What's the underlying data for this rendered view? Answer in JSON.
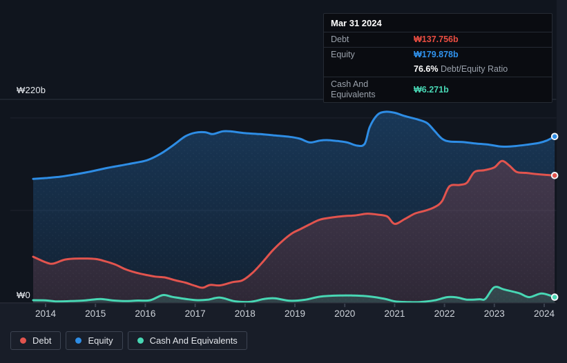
{
  "tooltip": {
    "date": "Mar 31 2024",
    "debt_label": "Debt",
    "debt_value": "₩137.756b",
    "equity_label": "Equity",
    "equity_value": "₩179.878b",
    "ratio_value": "76.6%",
    "ratio_label": "Debt/Equity Ratio",
    "cash_label": "Cash And Equivalents",
    "cash_value": "₩6.271b"
  },
  "legend": [
    {
      "label": "Debt",
      "key": "debt"
    },
    {
      "label": "Equity",
      "key": "equity"
    },
    {
      "label": "Cash And Equivalents",
      "key": "cash"
    }
  ],
  "colors": {
    "debt": "#e2544e",
    "equity": "#2e8de5",
    "cash": "#48d7b4",
    "page_bg": "#181d28",
    "plot_bg": "#10151e",
    "grid_major": "#2d323d",
    "grid_minor": "#1f242f",
    "tick": "#3a414e",
    "axis_text": "#ced3da"
  },
  "chart_data": {
    "type": "area",
    "x_unit": "year",
    "x_range": [
      2013.75,
      2024.21
    ],
    "x_ticks": [
      "2014",
      "2015",
      "2016",
      "2017",
      "2018",
      "2019",
      "2020",
      "2021",
      "2022",
      "2023",
      "2024"
    ],
    "ylim": [
      0,
      220
    ],
    "y_axis_labels": {
      "top": "₩220b",
      "zero": "₩0"
    },
    "gridlines_major": [
      220,
      0
    ],
    "gridlines_minor": [
      200,
      100
    ],
    "legend_position": "bottom-left",
    "end_point": {
      "date": "Mar 31 2024",
      "debt_b": 137.756,
      "equity_b": 179.878,
      "cash_b": 6.271,
      "debt_equity_ratio_pct": 76.6
    },
    "series": [
      {
        "name": "Equity",
        "key": "equity",
        "color": "#2e8de5",
        "points": [
          [
            2013.75,
            134
          ],
          [
            2014.0,
            135
          ],
          [
            2014.3,
            136.5
          ],
          [
            2014.6,
            139
          ],
          [
            2014.9,
            142
          ],
          [
            2015.2,
            145.5
          ],
          [
            2015.5,
            148.5
          ],
          [
            2015.8,
            151.5
          ],
          [
            2016.05,
            154.5
          ],
          [
            2016.3,
            161
          ],
          [
            2016.55,
            170
          ],
          [
            2016.8,
            180
          ],
          [
            2017.0,
            184
          ],
          [
            2017.2,
            184.5
          ],
          [
            2017.35,
            182.5
          ],
          [
            2017.55,
            185.5
          ],
          [
            2017.7,
            185.5
          ],
          [
            2018.0,
            183.5
          ],
          [
            2018.3,
            182.5
          ],
          [
            2018.6,
            181
          ],
          [
            2018.9,
            179.5
          ],
          [
            2019.1,
            177.5
          ],
          [
            2019.3,
            173.5
          ],
          [
            2019.5,
            175.5
          ],
          [
            2019.65,
            176
          ],
          [
            2019.85,
            175
          ],
          [
            2020.05,
            173.5
          ],
          [
            2020.25,
            170
          ],
          [
            2020.4,
            172
          ],
          [
            2020.5,
            190
          ],
          [
            2020.65,
            203
          ],
          [
            2020.8,
            206.5
          ],
          [
            2021.0,
            205.5
          ],
          [
            2021.2,
            202
          ],
          [
            2021.45,
            198.5
          ],
          [
            2021.65,
            194.5
          ],
          [
            2021.8,
            186
          ],
          [
            2021.95,
            177.5
          ],
          [
            2022.1,
            174.5
          ],
          [
            2022.35,
            174
          ],
          [
            2022.6,
            172.5
          ],
          [
            2022.9,
            171
          ],
          [
            2023.15,
            169
          ],
          [
            2023.4,
            169.5
          ],
          [
            2023.65,
            171
          ],
          [
            2023.9,
            173
          ],
          [
            2024.05,
            175.5
          ],
          [
            2024.21,
            179.878
          ]
        ]
      },
      {
        "name": "Debt",
        "key": "debt",
        "color": "#e2544e",
        "points": [
          [
            2013.75,
            50
          ],
          [
            2014.0,
            44
          ],
          [
            2014.15,
            42.5
          ],
          [
            2014.4,
            47
          ],
          [
            2014.7,
            48
          ],
          [
            2015.0,
            47.5
          ],
          [
            2015.2,
            45
          ],
          [
            2015.4,
            41.5
          ],
          [
            2015.6,
            36.5
          ],
          [
            2015.8,
            33
          ],
          [
            2016.0,
            30.5
          ],
          [
            2016.2,
            28.5
          ],
          [
            2016.4,
            27.5
          ],
          [
            2016.6,
            24.5
          ],
          [
            2016.8,
            22
          ],
          [
            2017.0,
            18.5
          ],
          [
            2017.15,
            16.5
          ],
          [
            2017.3,
            19.5
          ],
          [
            2017.5,
            19
          ],
          [
            2017.75,
            22.5
          ],
          [
            2017.95,
            24.5
          ],
          [
            2018.15,
            32.5
          ],
          [
            2018.35,
            44
          ],
          [
            2018.55,
            56.5
          ],
          [
            2018.75,
            67
          ],
          [
            2018.95,
            75.5
          ],
          [
            2019.1,
            79.5
          ],
          [
            2019.3,
            85
          ],
          [
            2019.5,
            90
          ],
          [
            2019.75,
            92.5
          ],
          [
            2020.0,
            94
          ],
          [
            2020.2,
            94.5
          ],
          [
            2020.45,
            96.5
          ],
          [
            2020.65,
            95.5
          ],
          [
            2020.85,
            93.5
          ],
          [
            2021.0,
            85.5
          ],
          [
            2021.2,
            90.5
          ],
          [
            2021.4,
            96.5
          ],
          [
            2021.6,
            99.5
          ],
          [
            2021.8,
            103.5
          ],
          [
            2021.95,
            110
          ],
          [
            2022.1,
            126
          ],
          [
            2022.3,
            127.5
          ],
          [
            2022.45,
            130
          ],
          [
            2022.6,
            141.5
          ],
          [
            2022.8,
            143.5
          ],
          [
            2023.0,
            146.5
          ],
          [
            2023.15,
            153.5
          ],
          [
            2023.3,
            148.5
          ],
          [
            2023.45,
            141.5
          ],
          [
            2023.65,
            140.5
          ],
          [
            2023.9,
            139
          ],
          [
            2024.21,
            137.756
          ]
        ]
      },
      {
        "name": "Cash And Equivalents",
        "key": "cash",
        "color": "#48d7b4",
        "points": [
          [
            2013.75,
            3
          ],
          [
            2014.0,
            2.8
          ],
          [
            2014.2,
            1.7
          ],
          [
            2014.5,
            2
          ],
          [
            2014.8,
            2.8
          ],
          [
            2015.1,
            4.3
          ],
          [
            2015.35,
            2.7
          ],
          [
            2015.6,
            2
          ],
          [
            2015.85,
            2.6
          ],
          [
            2016.1,
            3
          ],
          [
            2016.35,
            8.5
          ],
          [
            2016.55,
            6.5
          ],
          [
            2016.85,
            4
          ],
          [
            2017.05,
            3
          ],
          [
            2017.25,
            3.5
          ],
          [
            2017.5,
            5.8
          ],
          [
            2017.8,
            1.8
          ],
          [
            2018.1,
            1.2
          ],
          [
            2018.4,
            4.5
          ],
          [
            2018.6,
            5
          ],
          [
            2018.9,
            2.4
          ],
          [
            2019.2,
            3.4
          ],
          [
            2019.5,
            6.8
          ],
          [
            2019.85,
            8
          ],
          [
            2020.2,
            8
          ],
          [
            2020.5,
            7
          ],
          [
            2020.8,
            4.5
          ],
          [
            2021.0,
            1.8
          ],
          [
            2021.25,
            1
          ],
          [
            2021.5,
            1
          ],
          [
            2021.8,
            2.8
          ],
          [
            2022.05,
            6.3
          ],
          [
            2022.25,
            6
          ],
          [
            2022.45,
            3.6
          ],
          [
            2022.7,
            4
          ],
          [
            2022.82,
            4.5
          ],
          [
            2023.0,
            17
          ],
          [
            2023.2,
            14.5
          ],
          [
            2023.5,
            10.5
          ],
          [
            2023.7,
            6.3
          ],
          [
            2023.95,
            10.2
          ],
          [
            2024.21,
            6.271
          ]
        ]
      }
    ]
  }
}
